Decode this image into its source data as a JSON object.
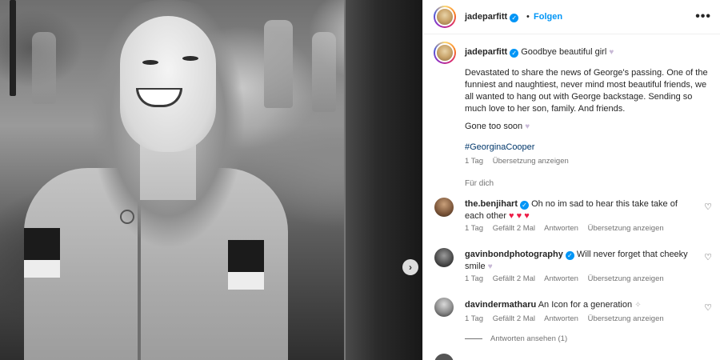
{
  "post": {
    "username": "jadeparfitt",
    "follow_label": "Folgen",
    "separator": "•",
    "more_icon": "more-horizontal-icon"
  },
  "caption": {
    "username": "jadeparfitt",
    "headline": "Goodbye beautiful girl",
    "body": "Devastated to share the news of George's passing. One of the funniest and naughtiest, never mind most beautiful friends, we all wanted to hang out with George backstage. Sending so much love to her son, family. And friends.",
    "closing": "Gone too soon",
    "hashtag": "#GeorginaCooper",
    "time": "1 Tag",
    "translate": "Übersetzung anzeigen"
  },
  "translate_for": "Für dich",
  "comments": [
    {
      "username": "the.benjihart",
      "text": "Oh no im sad to hear this take take of each other",
      "time": "1 Tag",
      "likes": "Gefällt 2 Mal",
      "reply": "Antworten",
      "translate": "Übersetzung anzeigen"
    },
    {
      "username": "gavinbondphotography",
      "text": "Will never forget that cheeky smile",
      "time": "1 Tag",
      "likes": "Gefällt 2 Mal",
      "reply": "Antworten",
      "translate": "Übersetzung anzeigen"
    },
    {
      "username": "davindermatharu",
      "text": "An Icon for a generation",
      "time": "1 Tag",
      "likes": "Gefällt 2 Mal",
      "reply": "Antworten",
      "translate": "Übersetzung anzeigen"
    }
  ],
  "view_replies": "Antworten ansehen (1)",
  "colors": {
    "accent": "#0095f6",
    "text": "#262626",
    "muted": "#737373",
    "hashtag": "#00376b",
    "heart_red": "#ed1c47"
  }
}
